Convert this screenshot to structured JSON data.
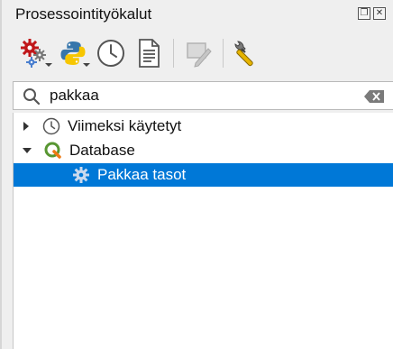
{
  "panel": {
    "title": "Prosessointityökalut",
    "float_icon": "float-icon",
    "close_icon": "close-icon"
  },
  "toolbar": {
    "buttons": [
      {
        "icon": "models-icon",
        "has_dropdown": true
      },
      {
        "icon": "python-icon",
        "has_dropdown": true
      },
      {
        "icon": "history-icon",
        "has_dropdown": false
      },
      {
        "icon": "results-viewer-icon",
        "has_dropdown": false
      },
      {
        "icon": "edit-features-in-place-icon",
        "has_dropdown": false,
        "disabled": true
      },
      {
        "icon": "options-icon",
        "has_dropdown": false
      }
    ]
  },
  "search": {
    "value": "pakkaa",
    "icon": "search-icon",
    "clear_icon": "clear-icon"
  },
  "tree": {
    "items": [
      {
        "label": "Viimeksi käytetyt",
        "icon": "clock-icon",
        "expanded": false
      },
      {
        "label": "Database",
        "icon": "qgis-icon",
        "expanded": true
      },
      {
        "label": "Pakkaa tasot",
        "icon": "gear-icon",
        "selected": true
      }
    ]
  },
  "colors": {
    "selection": "#0078d7",
    "panel_bg": "#efefef"
  }
}
